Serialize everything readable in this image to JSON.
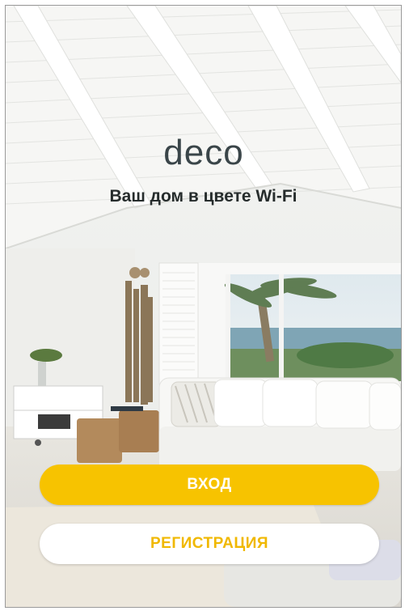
{
  "brand": {
    "logo_text": "deco",
    "tagline": "Ваш дом в цвете Wi-Fi"
  },
  "actions": {
    "login_label": "ВХОД",
    "register_label": "РЕГИСТРАЦИЯ"
  },
  "colors": {
    "accent": "#f7c300",
    "logo": "#3a4549"
  }
}
